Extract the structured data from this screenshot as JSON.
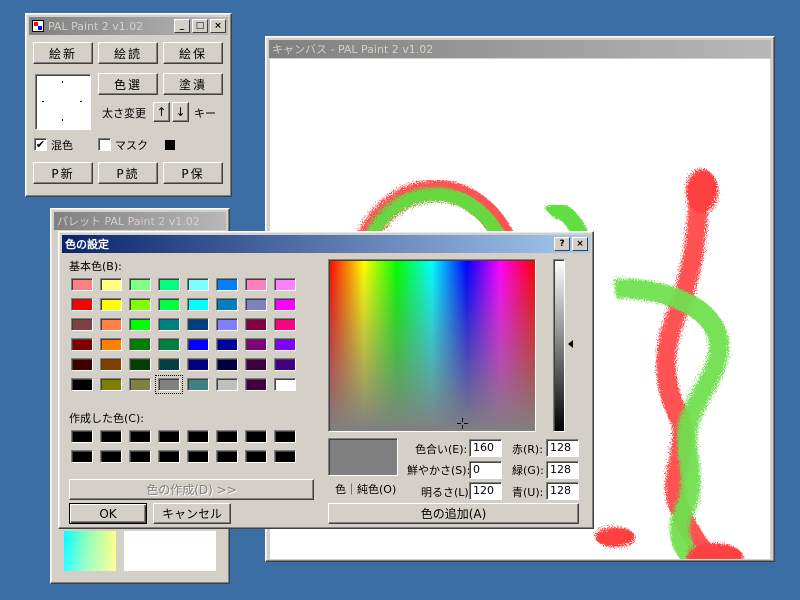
{
  "tool_window": {
    "title": "PAL Paint 2 v1.02",
    "buttons_row1": [
      "絵新",
      "絵読",
      "絵保"
    ],
    "color_select": "色選",
    "fill": "塗潰",
    "size_change_label": "太さ変更",
    "up_arrow": "↑",
    "down_arrow": "↓",
    "key_label": "キー",
    "mix_label": "混色",
    "mix_checked": true,
    "mask_label": "マスク",
    "mask_checked": false,
    "buttons_row2": [
      "P新",
      "P読",
      "P保"
    ]
  },
  "canvas_window": {
    "title": "キャンバス - PAL Paint 2 v1.02"
  },
  "palette_window": {
    "title": "パレット PAL Paint 2 v1.02"
  },
  "color_dialog": {
    "title": "色の設定",
    "help_button": "?",
    "close_button": "×",
    "basic_colors_label": "基本色(B):",
    "basic_colors": [
      "#ff8080",
      "#ffff80",
      "#80ff80",
      "#00ff80",
      "#80ffff",
      "#0080ff",
      "#ff80c0",
      "#ff80ff",
      "#ff0000",
      "#ffff00",
      "#80ff00",
      "#00ff40",
      "#00ffff",
      "#0080c0",
      "#8080c0",
      "#ff00ff",
      "#804040",
      "#ff8040",
      "#00ff00",
      "#008080",
      "#004080",
      "#8080ff",
      "#800040",
      "#ff0080",
      "#800000",
      "#ff8000",
      "#008000",
      "#008040",
      "#0000ff",
      "#0000a0",
      "#800080",
      "#8000ff",
      "#400000",
      "#804000",
      "#004000",
      "#004040",
      "#000080",
      "#000040",
      "#400040",
      "#400080",
      "#000000",
      "#808000",
      "#808040",
      "#808080",
      "#408080",
      "#c0c0c0",
      "#400040",
      "#ffffff"
    ],
    "selected_basic_index": 43,
    "custom_colors_label": "作成した色(C):",
    "custom_colors": [
      "#000000",
      "#000000",
      "#000000",
      "#000000",
      "#000000",
      "#000000",
      "#000000",
      "#000000",
      "#000000",
      "#000000",
      "#000000",
      "#000000",
      "#000000",
      "#000000",
      "#000000",
      "#000000"
    ],
    "define_custom_button": "色の作成(D) >>",
    "ok_button": "OK",
    "cancel_button": "キャンセル",
    "color_solid_label": "色｜純色(O)",
    "hue_label": "色合い(E):",
    "hue_value": "160",
    "sat_label": "鮮やかさ(S):",
    "sat_value": "0",
    "lum_label": "明るさ(L):",
    "lum_value": "120",
    "red_label": "赤(R):",
    "red_value": "128",
    "green_label": "緑(G):",
    "green_value": "128",
    "blue_label": "青(U):",
    "blue_value": "128",
    "current_color": "#808080",
    "add_custom_button": "色の追加(A)"
  }
}
